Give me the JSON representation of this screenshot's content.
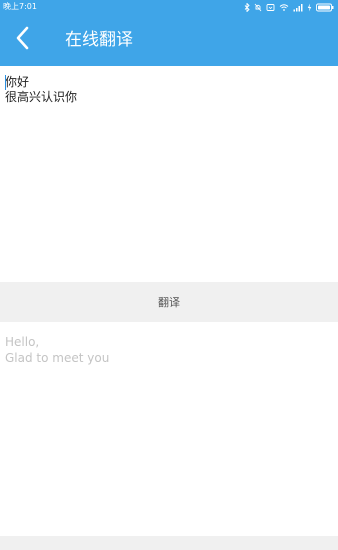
{
  "status_bar": {
    "time": "晚上7:01",
    "icons": [
      "bluetooth-icon",
      "mute-icon",
      "alarm-icon",
      "wifi-icon",
      "signal-icon",
      "charging-icon",
      "battery-icon"
    ]
  },
  "app_bar": {
    "title": "在线翻译",
    "back_icon": "chevron-left-icon"
  },
  "source": {
    "lines": [
      "你好",
      "很高兴认识你"
    ]
  },
  "translate_button": {
    "label": "翻译"
  },
  "result": {
    "lines": [
      "Hello,",
      "Glad to meet you"
    ]
  },
  "colors": {
    "accent": "#3fa5e8",
    "divider_bar": "#f0f0f0",
    "result_text": "#c4c4c4"
  }
}
